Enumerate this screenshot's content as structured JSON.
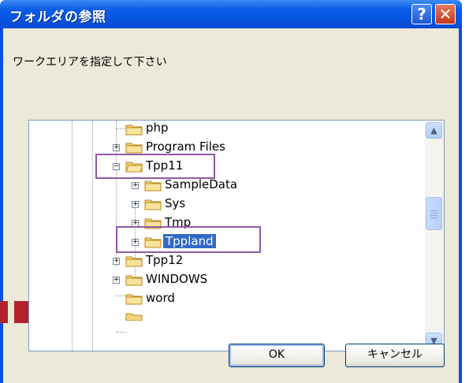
{
  "window": {
    "title": "フォルダの参照",
    "help_glyph": "?",
    "close_glyph": "✕"
  },
  "instruction": "ワークエリアを指定して下さい",
  "tree": {
    "items": [
      {
        "label": "php",
        "expander": "",
        "icon": "folder-icon"
      },
      {
        "label": "Program Files",
        "expander": "+",
        "icon": "folder-icon"
      },
      {
        "label": "Tpp11",
        "expander": "−",
        "icon": "folder-open-icon"
      },
      {
        "label": "SampleData",
        "expander": "+",
        "icon": "folder-icon"
      },
      {
        "label": "Sys",
        "expander": "+",
        "icon": "folder-icon"
      },
      {
        "label": "Tmp",
        "expander": "+",
        "icon": "folder-icon"
      },
      {
        "label": "Tppland",
        "expander": "+",
        "icon": "folder-icon",
        "selected": true
      },
      {
        "label": "Tpp12",
        "expander": "+",
        "icon": "folder-icon"
      },
      {
        "label": "WINDOWS",
        "expander": "+",
        "icon": "folder-icon"
      },
      {
        "label": "word",
        "expander": "",
        "icon": "folder-icon"
      }
    ],
    "scroll_up_glyph": "▲",
    "scroll_down_glyph": "▼"
  },
  "buttons": {
    "ok": "OK",
    "cancel": "キャンセル"
  },
  "colors": {
    "titlebar": "#0655e0",
    "selection": "#316ac5",
    "highlight_box": "#8e5aa6",
    "dialog_face": "#ece9d8"
  }
}
